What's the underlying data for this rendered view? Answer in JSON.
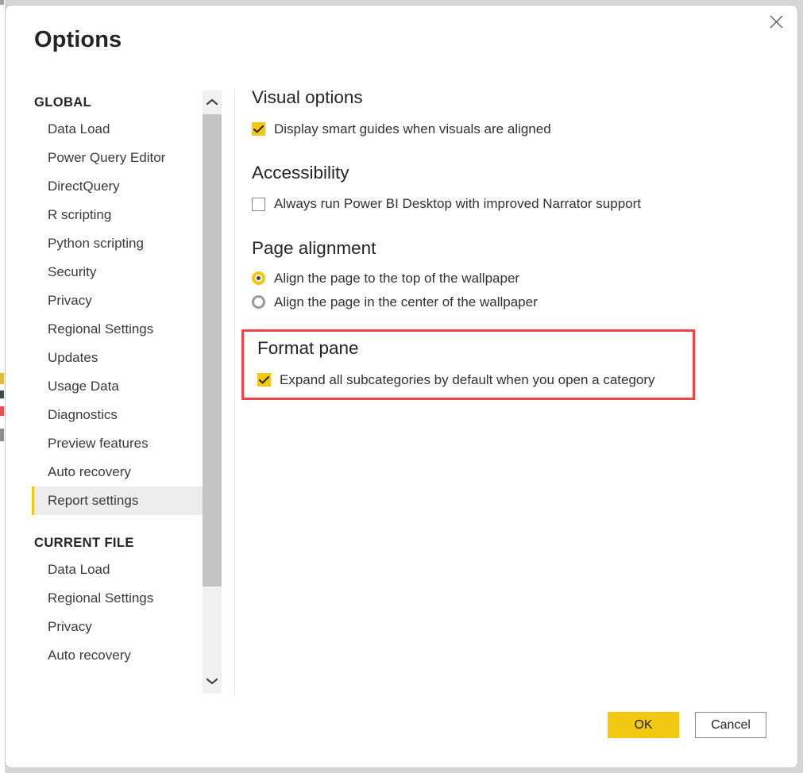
{
  "dialog": {
    "title": "Options",
    "close_icon": "close-icon"
  },
  "sidebar": {
    "groups": [
      {
        "header": "GLOBAL",
        "items": [
          {
            "label": "Data Load",
            "selected": false
          },
          {
            "label": "Power Query Editor",
            "selected": false
          },
          {
            "label": "DirectQuery",
            "selected": false
          },
          {
            "label": "R scripting",
            "selected": false
          },
          {
            "label": "Python scripting",
            "selected": false
          },
          {
            "label": "Security",
            "selected": false
          },
          {
            "label": "Privacy",
            "selected": false
          },
          {
            "label": "Regional Settings",
            "selected": false
          },
          {
            "label": "Updates",
            "selected": false
          },
          {
            "label": "Usage Data",
            "selected": false
          },
          {
            "label": "Diagnostics",
            "selected": false
          },
          {
            "label": "Preview features",
            "selected": false
          },
          {
            "label": "Auto recovery",
            "selected": false
          },
          {
            "label": "Report settings",
            "selected": true
          }
        ]
      },
      {
        "header": "CURRENT FILE",
        "items": [
          {
            "label": "Data Load",
            "selected": false
          },
          {
            "label": "Regional Settings",
            "selected": false
          },
          {
            "label": "Privacy",
            "selected": false
          },
          {
            "label": "Auto recovery",
            "selected": false
          }
        ]
      }
    ],
    "scrollbar": {
      "up_icon": "chevron-up-icon",
      "down_icon": "chevron-down-icon"
    }
  },
  "content": {
    "visual_options": {
      "title": "Visual options",
      "smart_guides": {
        "label": "Display smart guides when visuals are aligned",
        "checked": true
      }
    },
    "accessibility": {
      "title": "Accessibility",
      "narrator": {
        "label": "Always run Power BI Desktop with improved Narrator support",
        "checked": false
      }
    },
    "page_alignment": {
      "title": "Page alignment",
      "options": [
        {
          "label": "Align the page to the top of the wallpaper",
          "selected": true
        },
        {
          "label": "Align the page in the center of the wallpaper",
          "selected": false
        }
      ]
    },
    "format_pane": {
      "title": "Format pane",
      "expand_all": {
        "label": "Expand all subcategories by default when you open a category",
        "checked": true
      },
      "highlighted": true
    }
  },
  "footer": {
    "ok_label": "OK",
    "cancel_label": "Cancel"
  },
  "colors": {
    "accent_yellow": "#F2C811",
    "highlight_red": "#F0434A",
    "selected_nav_bg": "#EDEDED",
    "text_primary": "#252423",
    "text_secondary": "#3B3A39"
  }
}
